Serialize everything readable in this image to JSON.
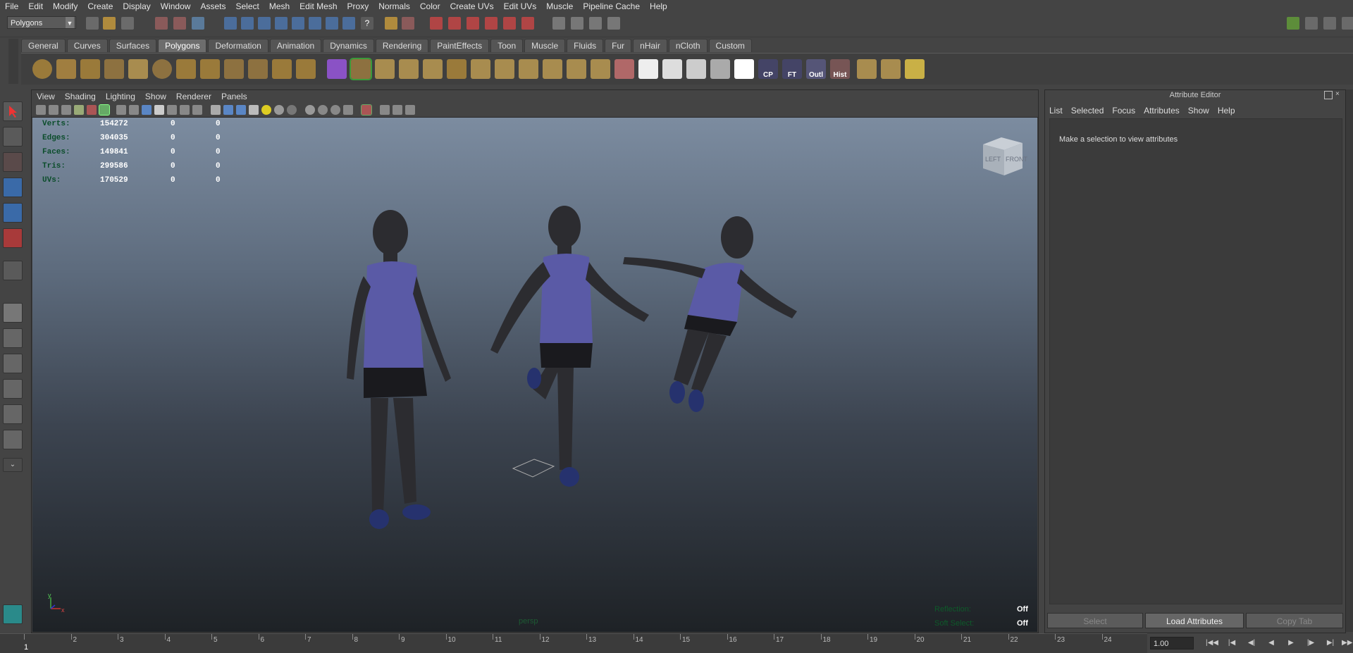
{
  "menubar": [
    "File",
    "Edit",
    "Modify",
    "Create",
    "Display",
    "Window",
    "Assets",
    "Select",
    "Mesh",
    "Edit Mesh",
    "Proxy",
    "Normals",
    "Color",
    "Create UVs",
    "Edit UVs",
    "Muscle",
    "Pipeline Cache",
    "Help"
  ],
  "status": {
    "mode": "Polygons"
  },
  "shelf_tabs": [
    "General",
    "Curves",
    "Surfaces",
    "Polygons",
    "Deformation",
    "Animation",
    "Dynamics",
    "Rendering",
    "PaintEffects",
    "Toon",
    "Muscle",
    "Fluids",
    "Fur",
    "nHair",
    "nCloth",
    "Custom"
  ],
  "shelf_active": "Polygons",
  "shelf_labels": {
    "cp": "CP",
    "ft": "FT",
    "outl": "Outl",
    "hist": "Hist"
  },
  "viewport_menu": [
    "View",
    "Shading",
    "Lighting",
    "Show",
    "Renderer",
    "Panels"
  ],
  "hud": [
    {
      "label": "Verts:",
      "v1": "154272",
      "v2": "0",
      "v3": "0"
    },
    {
      "label": "Edges:",
      "v1": "304035",
      "v2": "0",
      "v3": "0"
    },
    {
      "label": "Faces:",
      "v1": "149841",
      "v2": "0",
      "v3": "0"
    },
    {
      "label": "Tris:",
      "v1": "299586",
      "v2": "0",
      "v3": "0"
    },
    {
      "label": "UVs:",
      "v1": "170529",
      "v2": "0",
      "v3": "0"
    }
  ],
  "viewcube": {
    "front": "FRONT",
    "left": "LEFT"
  },
  "camera_label": "persp",
  "axis": {
    "y": "y",
    "x": "x"
  },
  "viewport_status": {
    "reflection_label": "Reflection:",
    "reflection_value": "Off",
    "soft_label": "Soft Select:",
    "soft_value": "Off"
  },
  "attr_editor": {
    "title": "Attribute Editor",
    "menu": [
      "List",
      "Selected",
      "Focus",
      "Attributes",
      "Show",
      "Help"
    ],
    "message": "Make a selection to view attributes",
    "select_btn": "Select",
    "load_btn": "Load Attributes",
    "copy_btn": "Copy Tab"
  },
  "timeline": {
    "ticks": [
      "1",
      "2",
      "3",
      "4",
      "5",
      "6",
      "7",
      "8",
      "9",
      "10",
      "11",
      "12",
      "13",
      "14",
      "15",
      "16",
      "17",
      "18",
      "19",
      "20",
      "21",
      "22",
      "23",
      "24"
    ],
    "current": "1",
    "speed": "1.00"
  },
  "colors": {
    "viewport_top": "#7c8ca0",
    "viewport_bottom": "#1e2226",
    "shirt": "#5a5aa6",
    "body": "#2c2c30"
  }
}
